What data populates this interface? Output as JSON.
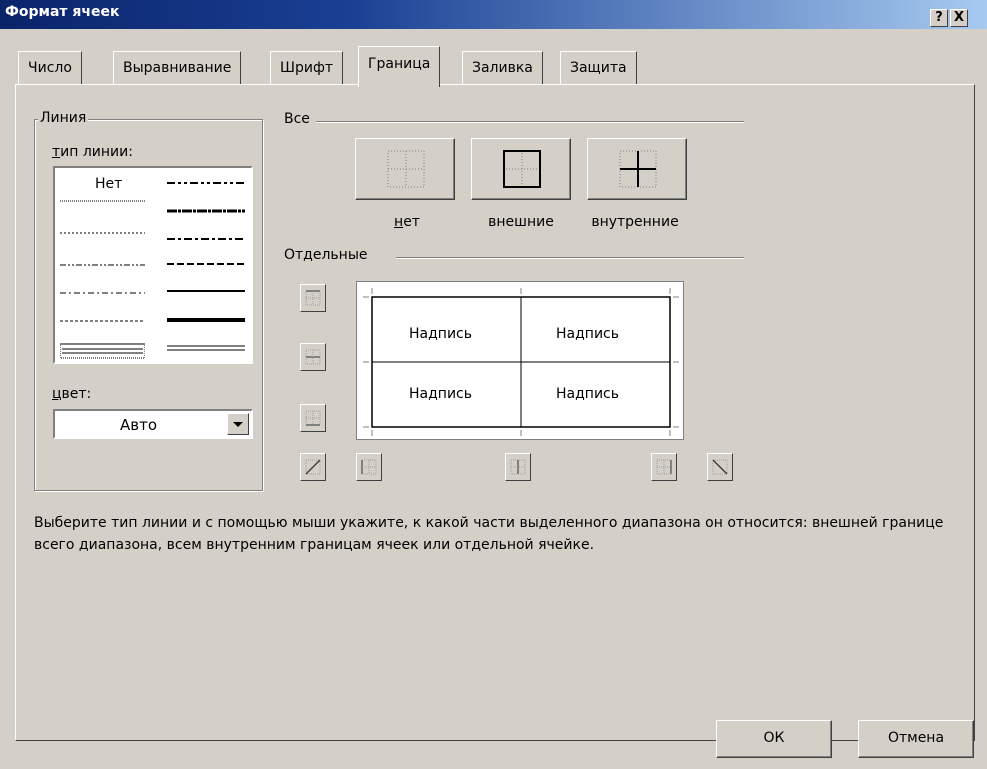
{
  "window": {
    "title": "Формат ячеек",
    "help_glyph": "?",
    "close_glyph": "X"
  },
  "tabs": [
    {
      "label": "Число"
    },
    {
      "label": "Выравнивание"
    },
    {
      "label": "Шрифт"
    },
    {
      "label": "Граница",
      "active": true
    },
    {
      "label": "Заливка"
    },
    {
      "label": "Защита"
    }
  ],
  "line_group": {
    "title": "Линия",
    "type_label": "тип линии:",
    "none_item": "Нет",
    "color_label": "цвет:",
    "color_value": "Авто"
  },
  "all_group": {
    "title": "Все",
    "presets": [
      {
        "label": "нет",
        "icon": "border-none-icon"
      },
      {
        "label": "внешние",
        "icon": "border-outline-icon"
      },
      {
        "label": "внутренние",
        "icon": "border-inside-icon"
      }
    ]
  },
  "individual_group": {
    "title": "Отдельные",
    "preview_cells": [
      "Надпись",
      "Надпись",
      "Надпись",
      "Надпись"
    ]
  },
  "hint": "Выберите тип линии и с помощью мыши укажите, к какой части выделенного диапазона он относится: внешней границе всего диапазона, всем внутренним границам ячеек или отдельной ячейке.",
  "buttons": {
    "ok": "ОК",
    "cancel": "Отмена"
  },
  "colors": {
    "title_start": "#0a246a",
    "title_end": "#a6caf0",
    "face": "#d4d0c8"
  }
}
